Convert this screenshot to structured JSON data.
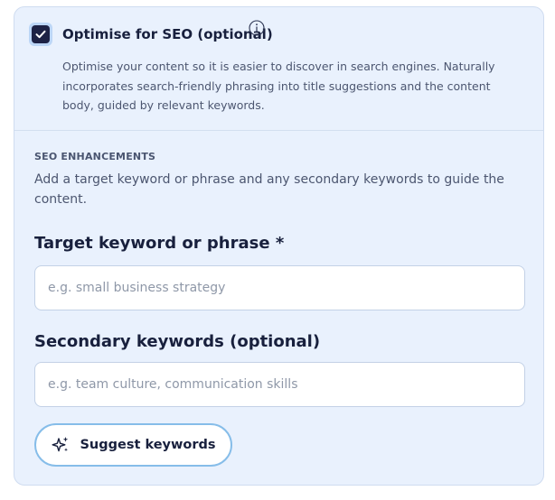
{
  "seo": {
    "checked": true,
    "title": "Optimise for SEO (optional)",
    "info_icon": "info-icon",
    "description": "Optimise your content so it is easier to discover in search engines. Naturally incorporates search-friendly phrasing into title suggestions and the content body, guided by relevant keywords."
  },
  "enhancements": {
    "section_label": "SEO ENHANCEMENTS",
    "help_text": "Add a target keyword or phrase and any secondary keywords to guide the content.",
    "target": {
      "label": "Target keyword or phrase *",
      "value": "",
      "placeholder": "e.g. small business strategy"
    },
    "secondary": {
      "label": "Secondary keywords (optional)",
      "value": "",
      "placeholder": "e.g. team culture, communication skills"
    },
    "suggest_button": {
      "label": "Suggest keywords",
      "icon": "sparkles-icon"
    }
  },
  "colors": {
    "panel_bg": "#e9f1fd",
    "checkbox_fill": "#1d2245",
    "button_border": "#86bde9",
    "heading_text": "#18203d"
  }
}
